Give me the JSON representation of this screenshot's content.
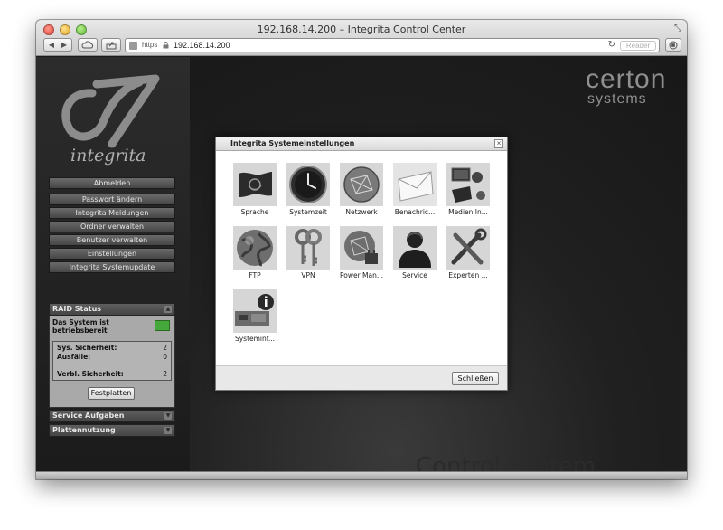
{
  "browser": {
    "window_title": "192.168.14.200 – Integrita Control Center",
    "back_glyph": "◀",
    "forward_glyph": "▶",
    "protocol": "https",
    "url": "192.168.14.200",
    "reader_label": "Reader"
  },
  "sidebar": {
    "logo_text": "integrita",
    "logout": "Abmelden",
    "menu": [
      "Passwort ändern",
      "Integrita Meldungen",
      "Ordner verwalten",
      "Benutzer verwalten",
      "Einstellungen",
      "Integrita Systemupdate"
    ]
  },
  "raid": {
    "title": "RAID Status",
    "system_status": "Das System ist betriebsbereit",
    "status_color": "#45a83a",
    "sys_safety_label": "Sys. Sicherheit:",
    "sys_safety_value": "2",
    "failures_label": "Ausfälle:",
    "failures_value": "0",
    "remaining_label": "Verbl. Sicherheit:",
    "remaining_value": "2",
    "disks_button": "Festplatten"
  },
  "panels": {
    "service": "Service Aufgaben",
    "disk_usage": "Plattennutzung"
  },
  "brand": {
    "main": "certon",
    "sub": "systems",
    "bg_text": "Control System"
  },
  "dialog": {
    "title": "Integrita Systemeinstellungen",
    "close_glyph": "×",
    "items": [
      {
        "label": "Sprache",
        "icon": "flag-icon"
      },
      {
        "label": "Systemzeit",
        "icon": "clock-icon"
      },
      {
        "label": "Netzwerk",
        "icon": "network-icon"
      },
      {
        "label": "Benachric...",
        "icon": "envelope-icon"
      },
      {
        "label": "Medien In...",
        "icon": "media-icon"
      },
      {
        "label": "FTP",
        "icon": "globe-icon"
      },
      {
        "label": "VPN",
        "icon": "keys-icon"
      },
      {
        "label": "Power Man...",
        "icon": "power-icon"
      },
      {
        "label": "Service",
        "icon": "person-icon"
      },
      {
        "label": "Experten ...",
        "icon": "tools-icon"
      },
      {
        "label": "Systeminf...",
        "icon": "system-info-icon"
      }
    ],
    "close_button": "Schließen"
  }
}
